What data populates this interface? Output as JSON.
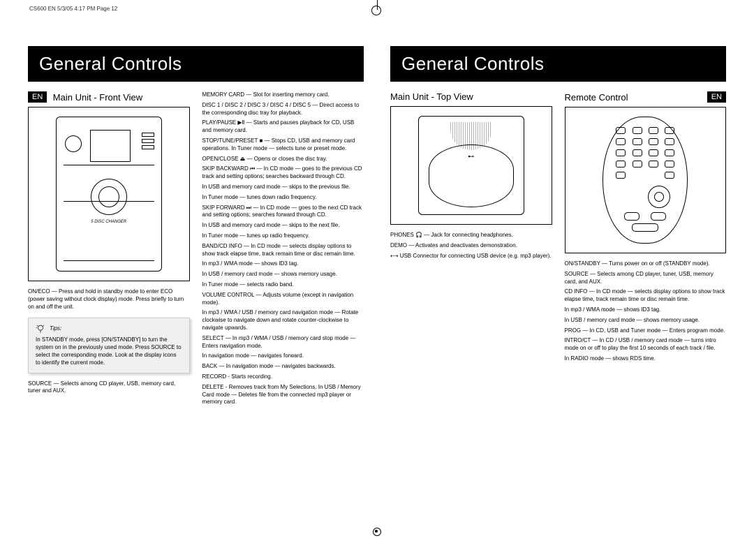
{
  "page_header": "CS600 EN  5/3/05  4:17 PM  Page 12",
  "left": {
    "title": "General Controls",
    "lang": "EN",
    "section": "Main Unit - Front View",
    "desc1": "ON/ECO — Press and hold in standby mode to enter ECO (power saving without clock display) mode. Press briefly to turn on and off the unit.",
    "tips_label": "Tips:",
    "tips_body": "In STANDBY mode, press [ON/STANDBY] to turn the system on in the previously used mode. Press SOURCE to select the corresponding mode. Look at the display icons to identify the current mode.",
    "desc2": "SOURCE — Selects among CD player, USB, memory card, tuner and AUX.",
    "changer_label": "5 DISC CHANGER",
    "col2": {
      "p1": "MEMORY CARD — Slot for inserting memory card.",
      "p2": "DISC 1 / DISC 2 / DISC 3 / DISC 4 / DISC 5 — Direct access to the corresponding disc tray for playback.",
      "p3": "PLAY/PAUSE ▶Ⅱ — Starts and pauses playback for CD, USB and memory card.",
      "p4": "STOP/TUNE/PRESET ■ — Stops CD, USB and memory card operations. In Tuner mode — selects tune or preset mode.",
      "p5": "OPEN/CLOSE ⏏ — Opens or closes the disc tray.",
      "p6": "SKIP BACKWARD ⏮ — In CD mode — goes to the previous CD track and setting options; searches backward through CD.",
      "p7": "In USB and memory card mode — skips to the previous file.",
      "p8": "In Tuner mode — tunes down radio frequency.",
      "p9": "SKIP FORWARD ⏭ — In CD mode — goes to the next CD track and setting options; searches forward through CD.",
      "p10": "In USB and memory card mode — skips to the next file.",
      "p11": "In Tuner mode — tunes up radio frequency.",
      "p12": "BAND/CD INFO — In CD mode — selects display options to show track elapse time, track remain time or disc remain time.",
      "p13": "In mp3 / WMA mode — shows ID3 tag.",
      "p14": "In USB / memory card mode — shows memory usage.",
      "p15": "In Tuner mode — selects radio band.",
      "p16": "VOLUME CONTROL — Adjusts volume (except in navigation mode).",
      "p17": "In mp3 / WMA / USB / memory card navigation mode — Rotate clockwise to navigate down and rotate counter-clockwise to navigate upwards.",
      "p18": "SELECT — In mp3 / WMA / USB / memory card stop mode — Enters navigation mode.",
      "p19": "In navigation mode — navigates forward.",
      "p20": "BACK — In navigation mode — navigates backwards.",
      "p21": "RECORD - Starts recording.",
      "p22": "DELETE - Removes track from My Selections. In USB / Memory Card mode — Deletes file from the connected mp3 player or memory card."
    }
  },
  "right": {
    "title": "General Controls",
    "lang": "EN",
    "section_top": "Main Unit - Top View",
    "section_remote": "Remote Control",
    "top_desc": {
      "p1": "PHONES 🎧 — Jack for connecting headphones.",
      "p2": "DEMO — Activates and deactivates demonstration.",
      "p3": "⟷ USB Connector for connecting USB device (e.g. mp3 player)."
    },
    "remote_desc": {
      "p1": "ON/STANDBY — Turns power on or off (STANDBY mode).",
      "p2": "SOURCE — Selects among CD player, tuner, USB, memory card, and AUX.",
      "p3": "CD INFO — In CD mode — selects display options to show track elapse time, track remain time or disc remain time.",
      "p4": "In mp3 / WMA mode — shows ID3 tag.",
      "p5": "In USB / memory card mode — shows memory usage.",
      "p6": "PROG — In CD, USB and Tuner mode — Enters program mode.",
      "p7": "INTRO/CT — In CD / USB / memory card mode — turns intro mode on or off to play the first 10 seconds of each track / file.",
      "p8": "In RADIO mode — shows RDS time."
    }
  }
}
